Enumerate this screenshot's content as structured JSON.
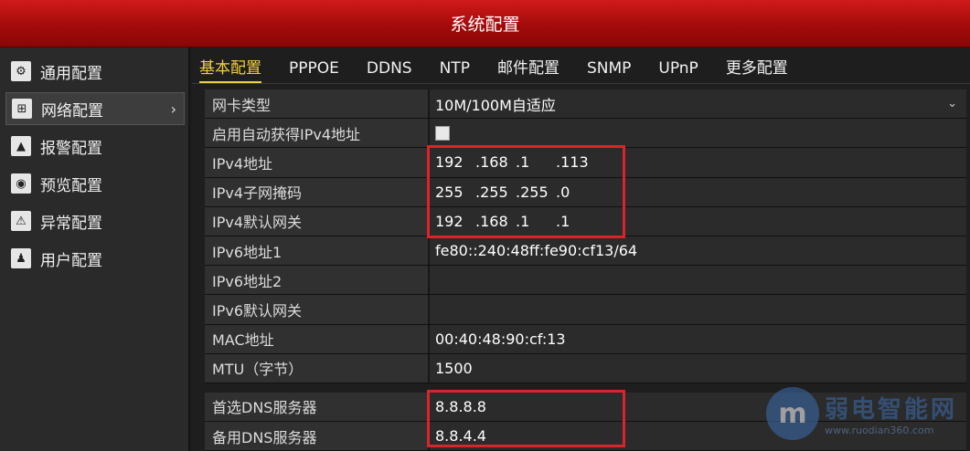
{
  "window": {
    "title": "系统配置"
  },
  "sidebar": {
    "items": [
      {
        "label": "通用配置",
        "icon": "gear-icon",
        "glyph": "⚙"
      },
      {
        "label": "网络配置",
        "icon": "network-icon",
        "glyph": "⊞",
        "arrow": "›"
      },
      {
        "label": "报警配置",
        "icon": "bell-icon",
        "glyph": "▲"
      },
      {
        "label": "预览配置",
        "icon": "eye-icon",
        "glyph": "◉"
      },
      {
        "label": "异常配置",
        "icon": "warning-icon",
        "glyph": "⚠"
      },
      {
        "label": "用户配置",
        "icon": "users-icon",
        "glyph": "♟"
      }
    ]
  },
  "tabs": [
    "基本配置",
    "PPPOE",
    "DDNS",
    "NTP",
    "邮件配置",
    "SNMP",
    "UPnP",
    "更多配置"
  ],
  "form": {
    "nic_type": {
      "label": "网卡类型",
      "value": "10M/100M自适应",
      "chevron": "⌄"
    },
    "dhcp": {
      "label": "启用自动获得IPv4地址"
    },
    "ipv4_address": {
      "label": "IPv4地址",
      "octets": [
        "192",
        ".168",
        ".1",
        ".113"
      ]
    },
    "ipv4_mask": {
      "label": "IPv4子网掩码",
      "octets": [
        "255",
        ".255",
        ".255",
        ".0"
      ]
    },
    "ipv4_gateway": {
      "label": "IPv4默认网关",
      "octets": [
        "192",
        ".168",
        ".1",
        ".1"
      ]
    },
    "ipv6_address1": {
      "label": "IPv6地址1",
      "value": "fe80::240:48ff:fe90:cf13/64"
    },
    "ipv6_address2": {
      "label": "IPv6地址2",
      "value": ""
    },
    "ipv6_gateway": {
      "label": "IPv6默认网关",
      "value": ""
    },
    "mac": {
      "label": "MAC地址",
      "value": "00:40:48:90:cf:13"
    },
    "mtu": {
      "label": "MTU（字节）",
      "value": "1500"
    },
    "dns_primary": {
      "label": "首选DNS服务器",
      "value": "8.8.8.8"
    },
    "dns_secondary": {
      "label": "备用DNS服务器",
      "value": "8.8.4.4"
    }
  },
  "watermark": {
    "title": "弱电智能网",
    "url": "www.ruodian360.com"
  },
  "colors": {
    "titlebar": "#b81212",
    "active_tab": "#f0d040",
    "highlight_box": "#d9252a"
  }
}
